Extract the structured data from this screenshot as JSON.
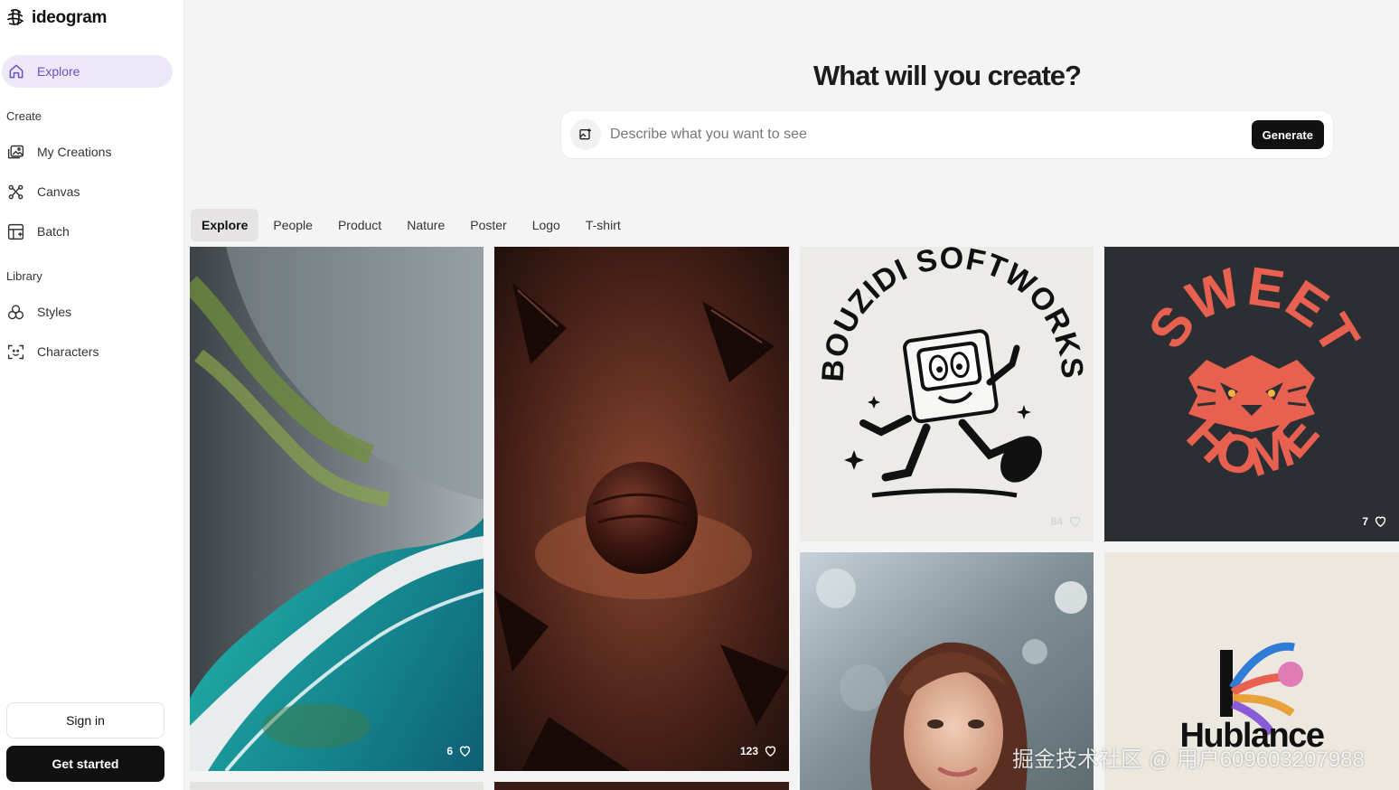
{
  "brand": {
    "name": "ideogram"
  },
  "sidebar": {
    "explore_label": "Explore",
    "create_section": "Create",
    "create_items": [
      {
        "label": "My Creations",
        "icon": "gallery-icon"
      },
      {
        "label": "Canvas",
        "icon": "canvas-icon"
      },
      {
        "label": "Batch",
        "icon": "batch-icon"
      }
    ],
    "library_section": "Library",
    "library_items": [
      {
        "label": "Styles",
        "icon": "styles-icon"
      },
      {
        "label": "Characters",
        "icon": "characters-icon"
      }
    ],
    "sign_in": "Sign in",
    "get_started": "Get started"
  },
  "main": {
    "headline": "What will you create?",
    "prompt_placeholder": "Describe what you want to see",
    "generate_label": "Generate",
    "tabs": [
      "Explore",
      "People",
      "Product",
      "Nature",
      "Poster",
      "Logo",
      "T-shirt"
    ],
    "active_tab": "Explore"
  },
  "gallery": [
    {
      "name": "coastal-cliff-image",
      "likes": "6"
    },
    {
      "name": "chocolate-truffle-image",
      "likes": "123"
    },
    {
      "name": "bouzidi-softworks-logo",
      "likes": "84",
      "text": "BOUZIDI SOFTWORKS"
    },
    {
      "name": "sweet-home-lion-logo",
      "likes": "7",
      "text_top": "SWEET",
      "text_bottom": "HOME"
    },
    {
      "name": "woman-portrait-image"
    },
    {
      "name": "hublance-logo",
      "text": "Hublance"
    }
  ],
  "watermark": "掘金技术社区 @ 用户609603207988",
  "colors": {
    "accent": "#6b4fc6",
    "dark": "#111111",
    "coral": "#e8604f"
  }
}
